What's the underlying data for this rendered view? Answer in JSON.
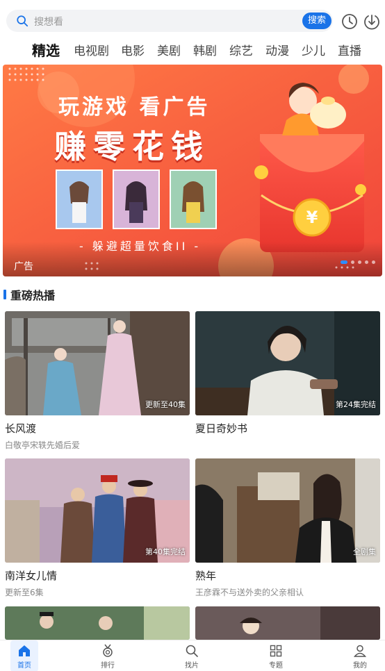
{
  "search": {
    "placeholder": "搜想看",
    "button_label": "搜索",
    "icons": [
      "search-icon",
      "history-clock-icon",
      "download-icon"
    ]
  },
  "tabs": [
    {
      "label": "精选",
      "active": true
    },
    {
      "label": "电视剧"
    },
    {
      "label": "电影"
    },
    {
      "label": "美剧"
    },
    {
      "label": "韩剧"
    },
    {
      "label": "综艺"
    },
    {
      "label": "动漫"
    },
    {
      "label": "少儿"
    },
    {
      "label": "直播"
    }
  ],
  "banner": {
    "headline_1": "玩游戏 看广告",
    "headline_2": "赚零花钱",
    "caption": "- 躲避超量饮食II -",
    "ad_label": "广告",
    "coin_symbol": "¥",
    "slide_count": 5,
    "active_slide": 1
  },
  "section": {
    "title": "重磅热播"
  },
  "cards": [
    {
      "title": "长风渡",
      "subtitle": "白敬亭宋轶先婚后爱",
      "status": "更新至40集"
    },
    {
      "title": "夏日奇妙书",
      "subtitle": "",
      "status": "第24集完结"
    },
    {
      "title": "南洋女儿情",
      "subtitle": "更新至6集",
      "status": "第40集完结"
    },
    {
      "title": "熟年",
      "subtitle": "王彦霖不与送外卖的父亲相认",
      "status": "全剧集"
    }
  ],
  "bottom_nav": [
    {
      "label": "首页",
      "icon": "home-icon",
      "active": true
    },
    {
      "label": "排行",
      "icon": "medal-icon"
    },
    {
      "label": "找片",
      "icon": "search-icon"
    },
    {
      "label": "专题",
      "icon": "grid-icon"
    },
    {
      "label": "我的",
      "icon": "user-icon"
    }
  ],
  "colors": {
    "accent": "#1a73e8",
    "banner_bg": "#f25a3c"
  }
}
